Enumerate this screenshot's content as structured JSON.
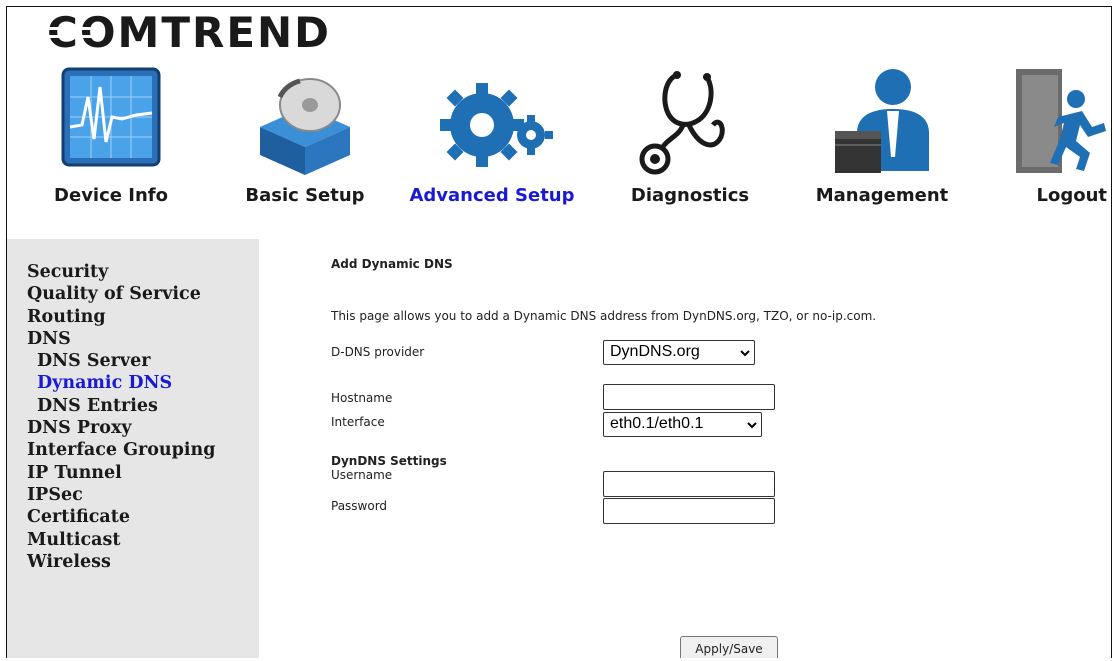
{
  "brand": {
    "logo_text": "COMTREND"
  },
  "nav": [
    {
      "label": "Device Info",
      "icon": "device-info-icon",
      "active": false
    },
    {
      "label": "Basic Setup",
      "icon": "basic-setup-icon",
      "active": false
    },
    {
      "label": "Advanced Setup",
      "icon": "advanced-setup-icon",
      "active": true
    },
    {
      "label": "Diagnostics",
      "icon": "diagnostics-icon",
      "active": false
    },
    {
      "label": "Management",
      "icon": "management-icon",
      "active": false
    },
    {
      "label": "Logout",
      "icon": "logout-icon",
      "active": false
    }
  ],
  "sidebar": {
    "items": [
      {
        "label": "Security"
      },
      {
        "label": "Quality of Service"
      },
      {
        "label": "Routing"
      },
      {
        "label": "DNS"
      },
      {
        "label": "DNS Server",
        "sub": true
      },
      {
        "label": "Dynamic DNS",
        "sub": true,
        "active": true
      },
      {
        "label": "DNS Entries",
        "sub": true
      },
      {
        "label": "DNS Proxy"
      },
      {
        "label": "Interface Grouping"
      },
      {
        "label": "IP Tunnel"
      },
      {
        "label": "IPSec"
      },
      {
        "label": "Certificate"
      },
      {
        "label": "Multicast"
      },
      {
        "label": "Wireless"
      }
    ]
  },
  "main": {
    "title": "Add Dynamic DNS",
    "description": "This page allows you to add a Dynamic DNS address from DynDNS.org, TZO, or no-ip.com.",
    "provider_label": "D-DNS provider",
    "provider_value": "DynDNS.org",
    "hostname_label": "Hostname",
    "hostname_value": "",
    "interface_label": "Interface",
    "interface_value": "eth0.1/eth0.1",
    "settings_heading": "DynDNS Settings",
    "username_label": "Username",
    "username_value": "",
    "password_label": "Password",
    "password_value": "",
    "apply_label": "Apply/Save"
  },
  "colors": {
    "active_link": "#1a1ad6",
    "sidebar_bg": "#e6e6e6",
    "icon_blue": "#1f6fb5"
  }
}
